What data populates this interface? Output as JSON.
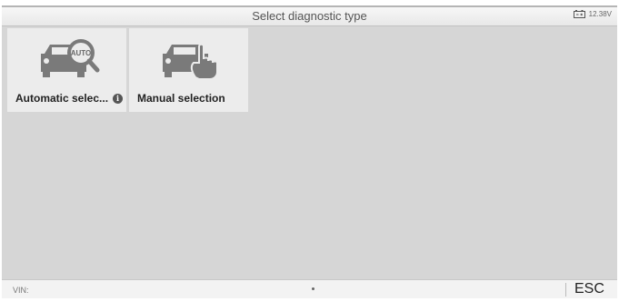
{
  "header": {
    "title": "Select diagnostic type",
    "battery_voltage": "12.38V",
    "battery_icon": "battery-icon"
  },
  "tiles": [
    {
      "label": "Automatic selec...",
      "icon": "car-auto-search-icon",
      "badge_icon": "AUTO",
      "info_icon": "info-icon"
    },
    {
      "label": "Manual selection",
      "icon": "car-manual-touch-icon"
    }
  ],
  "footer": {
    "vin_label": "VIN:",
    "esc_label": "ESC"
  },
  "colors": {
    "background": "#d6d6d6",
    "tile": "#ececec",
    "icon_gray": "#7a7a7a"
  }
}
